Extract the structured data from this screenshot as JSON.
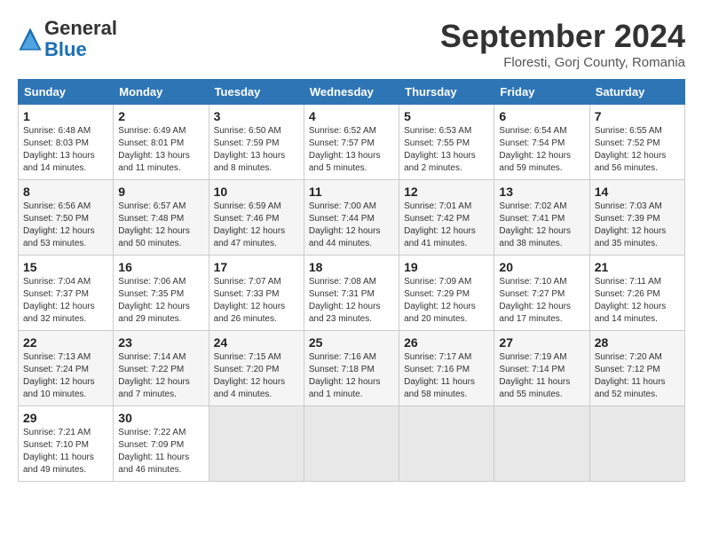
{
  "header": {
    "logo_line1": "General",
    "logo_line2": "Blue",
    "month": "September 2024",
    "location": "Floresti, Gorj County, Romania"
  },
  "weekdays": [
    "Sunday",
    "Monday",
    "Tuesday",
    "Wednesday",
    "Thursday",
    "Friday",
    "Saturday"
  ],
  "weeks": [
    [
      {
        "day": "1",
        "sunrise": "6:48 AM",
        "sunset": "8:03 PM",
        "daylight": "13 hours and 14 minutes."
      },
      {
        "day": "2",
        "sunrise": "6:49 AM",
        "sunset": "8:01 PM",
        "daylight": "13 hours and 11 minutes."
      },
      {
        "day": "3",
        "sunrise": "6:50 AM",
        "sunset": "7:59 PM",
        "daylight": "13 hours and 8 minutes."
      },
      {
        "day": "4",
        "sunrise": "6:52 AM",
        "sunset": "7:57 PM",
        "daylight": "13 hours and 5 minutes."
      },
      {
        "day": "5",
        "sunrise": "6:53 AM",
        "sunset": "7:55 PM",
        "daylight": "13 hours and 2 minutes."
      },
      {
        "day": "6",
        "sunrise": "6:54 AM",
        "sunset": "7:54 PM",
        "daylight": "12 hours and 59 minutes."
      },
      {
        "day": "7",
        "sunrise": "6:55 AM",
        "sunset": "7:52 PM",
        "daylight": "12 hours and 56 minutes."
      }
    ],
    [
      {
        "day": "8",
        "sunrise": "6:56 AM",
        "sunset": "7:50 PM",
        "daylight": "12 hours and 53 minutes."
      },
      {
        "day": "9",
        "sunrise": "6:57 AM",
        "sunset": "7:48 PM",
        "daylight": "12 hours and 50 minutes."
      },
      {
        "day": "10",
        "sunrise": "6:59 AM",
        "sunset": "7:46 PM",
        "daylight": "12 hours and 47 minutes."
      },
      {
        "day": "11",
        "sunrise": "7:00 AM",
        "sunset": "7:44 PM",
        "daylight": "12 hours and 44 minutes."
      },
      {
        "day": "12",
        "sunrise": "7:01 AM",
        "sunset": "7:42 PM",
        "daylight": "12 hours and 41 minutes."
      },
      {
        "day": "13",
        "sunrise": "7:02 AM",
        "sunset": "7:41 PM",
        "daylight": "12 hours and 38 minutes."
      },
      {
        "day": "14",
        "sunrise": "7:03 AM",
        "sunset": "7:39 PM",
        "daylight": "12 hours and 35 minutes."
      }
    ],
    [
      {
        "day": "15",
        "sunrise": "7:04 AM",
        "sunset": "7:37 PM",
        "daylight": "12 hours and 32 minutes."
      },
      {
        "day": "16",
        "sunrise": "7:06 AM",
        "sunset": "7:35 PM",
        "daylight": "12 hours and 29 minutes."
      },
      {
        "day": "17",
        "sunrise": "7:07 AM",
        "sunset": "7:33 PM",
        "daylight": "12 hours and 26 minutes."
      },
      {
        "day": "18",
        "sunrise": "7:08 AM",
        "sunset": "7:31 PM",
        "daylight": "12 hours and 23 minutes."
      },
      {
        "day": "19",
        "sunrise": "7:09 AM",
        "sunset": "7:29 PM",
        "daylight": "12 hours and 20 minutes."
      },
      {
        "day": "20",
        "sunrise": "7:10 AM",
        "sunset": "7:27 PM",
        "daylight": "12 hours and 17 minutes."
      },
      {
        "day": "21",
        "sunrise": "7:11 AM",
        "sunset": "7:26 PM",
        "daylight": "12 hours and 14 minutes."
      }
    ],
    [
      {
        "day": "22",
        "sunrise": "7:13 AM",
        "sunset": "7:24 PM",
        "daylight": "12 hours and 10 minutes."
      },
      {
        "day": "23",
        "sunrise": "7:14 AM",
        "sunset": "7:22 PM",
        "daylight": "12 hours and 7 minutes."
      },
      {
        "day": "24",
        "sunrise": "7:15 AM",
        "sunset": "7:20 PM",
        "daylight": "12 hours and 4 minutes."
      },
      {
        "day": "25",
        "sunrise": "7:16 AM",
        "sunset": "7:18 PM",
        "daylight": "12 hours and 1 minute."
      },
      {
        "day": "26",
        "sunrise": "7:17 AM",
        "sunset": "7:16 PM",
        "daylight": "11 hours and 58 minutes."
      },
      {
        "day": "27",
        "sunrise": "7:19 AM",
        "sunset": "7:14 PM",
        "daylight": "11 hours and 55 minutes."
      },
      {
        "day": "28",
        "sunrise": "7:20 AM",
        "sunset": "7:12 PM",
        "daylight": "11 hours and 52 minutes."
      }
    ],
    [
      {
        "day": "29",
        "sunrise": "7:21 AM",
        "sunset": "7:10 PM",
        "daylight": "11 hours and 49 minutes."
      },
      {
        "day": "30",
        "sunrise": "7:22 AM",
        "sunset": "7:09 PM",
        "daylight": "11 hours and 46 minutes."
      },
      null,
      null,
      null,
      null,
      null
    ]
  ]
}
